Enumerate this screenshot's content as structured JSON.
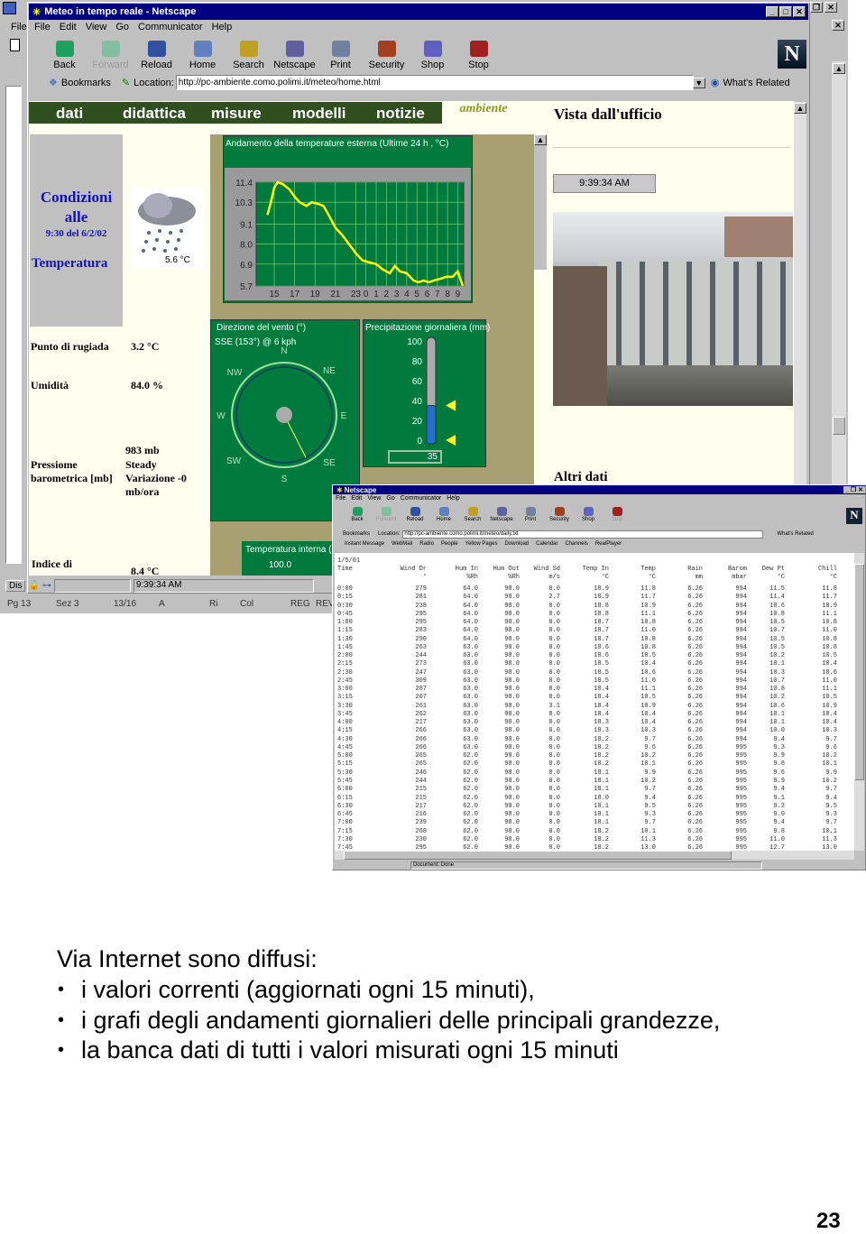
{
  "outer": {
    "menu_file": "File",
    "status": "Dis",
    "word_status": [
      "Pg 13",
      "Sez 3",
      "13/16",
      "A",
      "Ri",
      "Col",
      "REG",
      "REV"
    ]
  },
  "browser": {
    "title": "Meteo in tempo reale - Netscape",
    "menu": [
      "File",
      "Edit",
      "View",
      "Go",
      "Communicator",
      "Help"
    ],
    "toolbar": [
      "Back",
      "Forward",
      "Reload",
      "Home",
      "Search",
      "Netscape",
      "Print",
      "Security",
      "Shop",
      "Stop"
    ],
    "bookmarks": "Bookmarks",
    "location_label": "Location:",
    "url": "http://pc-ambiente.como.polimi.it/meteo/home.html",
    "whats_related": "What's Related",
    "status_time": "9:39:34 AM"
  },
  "site": {
    "nav": [
      "dati",
      "didattica",
      "misure",
      "modelli",
      "notizie"
    ],
    "logo": "ambiente como",
    "conditions_title": "Condizioni alle",
    "conditions_time": "9:30 del 6/2/02",
    "temperature_label": "Temperatura",
    "temperature_value": "5.6 °C",
    "dew_label": "Punto di rugiada",
    "dew_value": "3.2 °C",
    "hum_label": "Umidità",
    "hum_value": "84.0 %",
    "press_label": "Pressiome barometrica [mb]",
    "press_value": "983 mb",
    "press_trend": "Steady",
    "press_var": "Variazione -0 mb/ora",
    "index_label": "Indice di",
    "index_value": "8.4 °C",
    "view_title": "Vista dall'ufficio",
    "view_time": "9:39:34 AM",
    "other_title": "Altri dati",
    "temp_chart": {
      "title": "Andamento della temperature  esterna (Ultime 24 h  , °C)",
      "y_ticks": [
        "11.4",
        "10.3",
        "9.1",
        "8.0",
        "6.9",
        "5.7"
      ],
      "ylim": [
        5.7,
        11.4
      ],
      "x_ticks": [
        "15",
        "17",
        "19",
        "21",
        "23",
        "0",
        "1",
        "2",
        "3",
        "4",
        "5",
        "6",
        "7",
        "8",
        "9"
      ],
      "points": [
        [
          "14:20",
          9.6
        ],
        [
          "14:40",
          10.3
        ],
        [
          "15:00",
          11.1
        ],
        [
          "15:20",
          11.4
        ],
        [
          "15:50",
          11.3
        ],
        [
          "16:30",
          11.0
        ],
        [
          "17:00",
          10.6
        ],
        [
          "17:30",
          10.3
        ],
        [
          "18:10",
          10.1
        ],
        [
          "18:40",
          10.3
        ],
        [
          "19:20",
          10.2
        ],
        [
          "19:50",
          10.1
        ],
        [
          "20:20",
          9.6
        ],
        [
          "21:00",
          8.9
        ],
        [
          "21:40",
          8.5
        ],
        [
          "22:20",
          8.0
        ],
        [
          "23:00",
          7.5
        ],
        [
          "23:40",
          7.1
        ],
        [
          "0:20",
          7.0
        ],
        [
          "1:00",
          6.9
        ],
        [
          "1:40",
          6.6
        ],
        [
          "2:20",
          6.4
        ],
        [
          "2:50",
          6.8
        ],
        [
          "3:20",
          6.5
        ],
        [
          "4:00",
          6.4
        ],
        [
          "4:40",
          6.0
        ],
        [
          "5:10",
          5.9
        ],
        [
          "5:40",
          6.0
        ],
        [
          "6:10",
          5.9
        ],
        [
          "6:40",
          6.0
        ],
        [
          "7:20",
          6.1
        ],
        [
          "7:50",
          6.2
        ],
        [
          "8:30",
          6.2
        ],
        [
          "9:00",
          6.5
        ],
        [
          "9:30",
          5.7
        ]
      ],
      "line_color": "#ffff00",
      "bg_color": "#007a3d"
    },
    "wind": {
      "title": "Direzione del vento (°)",
      "reading": "SSE (153°) @ 6 kph",
      "direction_deg": 153,
      "labels": [
        "N",
        "NE",
        "E",
        "SE",
        "S",
        "SW",
        "W",
        "NW"
      ]
    },
    "precip": {
      "title": "Precipitazione giornaliera (mm)",
      "ticks": [
        "100",
        "80",
        "60",
        "40",
        "20",
        "0"
      ],
      "level_mm": 35,
      "value": "35"
    },
    "internal": {
      "title": "Temperatura interna (°C)",
      "tick": "100.0"
    }
  },
  "browser2": {
    "title": "Netscape",
    "menu": [
      "File",
      "Edit",
      "View",
      "Go",
      "Communicator",
      "Help"
    ],
    "toolbar": [
      "Back",
      "Forward",
      "Reload",
      "Home",
      "Search",
      "Netscape",
      "Print",
      "Security",
      "Shop",
      "Stop"
    ],
    "bookmarks": "Bookmarks",
    "location_label": "Location:",
    "url": "http://pc-ambiente.como.polimi.it/meteo/daily.txt",
    "whats_related": "What's Related",
    "personal": [
      "Instant Message",
      "WebMail",
      "Radio",
      "People",
      "Yellow Pages",
      "Download",
      "Calendar",
      "Channels",
      "RealPlayer"
    ],
    "status": "Document: Done",
    "date": "1/5/01",
    "headers": [
      "Time",
      "Wind Dr",
      "Hum In",
      "Hum Out",
      "Wind Sd",
      "Temp In",
      "Temp",
      "Rain",
      "Barom",
      "Dew Pt",
      "Chill"
    ],
    "units": [
      "",
      "°",
      "%Rh",
      "%Rh",
      "m/s",
      "°C",
      "°C",
      "mm",
      "mbar",
      "°C",
      "°C"
    ],
    "rows": [
      [
        "0:00",
        "279",
        "64.0",
        "98.0",
        "0.0",
        "18.9",
        "11.8",
        "6.26",
        "994",
        "11.5",
        "11.8"
      ],
      [
        "0:15",
        "281",
        "64.0",
        "98.0",
        "2.7",
        "18.9",
        "11.7",
        "6.26",
        "994",
        "11.4",
        "11.7"
      ],
      [
        "0:30",
        "238",
        "64.0",
        "98.0",
        "0.0",
        "18.8",
        "10.9",
        "6.26",
        "994",
        "10.6",
        "10.9"
      ],
      [
        "0:45",
        "295",
        "64.0",
        "98.0",
        "0.0",
        "18.8",
        "11.1",
        "6.26",
        "994",
        "10.8",
        "11.1"
      ],
      [
        "1:00",
        "295",
        "64.0",
        "98.0",
        "0.0",
        "18.7",
        "10.8",
        "6.26",
        "994",
        "10.5",
        "10.8"
      ],
      [
        "1:15",
        "283",
        "64.0",
        "98.0",
        "0.0",
        "18.7",
        "11.0",
        "6.26",
        "994",
        "10.7",
        "11.0"
      ],
      [
        "1:30",
        "290",
        "64.0",
        "98.0",
        "0.0",
        "18.7",
        "10.8",
        "6.26",
        "994",
        "10.5",
        "10.8"
      ],
      [
        "1:45",
        "263",
        "63.0",
        "98.0",
        "0.0",
        "18.6",
        "10.8",
        "6.26",
        "994",
        "10.5",
        "10.8"
      ],
      [
        "2:00",
        "244",
        "63.0",
        "98.0",
        "0.0",
        "18.6",
        "10.5",
        "6.26",
        "994",
        "10.2",
        "10.5"
      ],
      [
        "2:15",
        "273",
        "63.0",
        "98.0",
        "0.0",
        "18.5",
        "10.4",
        "6.26",
        "994",
        "10.1",
        "10.4"
      ],
      [
        "2:30",
        "247",
        "63.0",
        "98.0",
        "0.0",
        "18.5",
        "10.6",
        "6.26",
        "994",
        "10.3",
        "10.6"
      ],
      [
        "2:45",
        "309",
        "63.0",
        "98.0",
        "0.0",
        "18.5",
        "11.0",
        "6.26",
        "994",
        "10.7",
        "11.0"
      ],
      [
        "3:00",
        "287",
        "63.0",
        "98.0",
        "0.0",
        "18.4",
        "11.1",
        "6.26",
        "994",
        "10.8",
        "11.1"
      ],
      [
        "3:15",
        "207",
        "63.0",
        "98.0",
        "0.0",
        "18.4",
        "10.5",
        "6.26",
        "994",
        "10.2",
        "10.5"
      ],
      [
        "3:30",
        "261",
        "63.0",
        "98.0",
        "3.1",
        "18.4",
        "10.9",
        "6.26",
        "994",
        "10.6",
        "10.9"
      ],
      [
        "3:45",
        "262",
        "63.0",
        "98.0",
        "0.0",
        "18.4",
        "10.4",
        "6.26",
        "994",
        "10.1",
        "10.4"
      ],
      [
        "4:00",
        "217",
        "63.0",
        "98.0",
        "0.0",
        "18.3",
        "10.4",
        "6.26",
        "994",
        "10.1",
        "10.4"
      ],
      [
        "4:15",
        "266",
        "63.0",
        "98.0",
        "0.0",
        "18.3",
        "10.3",
        "6.26",
        "994",
        "10.0",
        "10.3"
      ],
      [
        "4:30",
        "266",
        "63.0",
        "98.0",
        "0.0",
        "18.2",
        "9.7",
        "6.26",
        "994",
        "9.4",
        "9.7"
      ],
      [
        "4:45",
        "266",
        "63.0",
        "98.0",
        "0.0",
        "18.2",
        "9.6",
        "6.26",
        "995",
        "9.3",
        "9.6"
      ],
      [
        "5:00",
        "265",
        "62.0",
        "98.0",
        "0.0",
        "18.2",
        "10.2",
        "6.26",
        "995",
        "9.9",
        "10.2"
      ],
      [
        "5:15",
        "265",
        "62.0",
        "98.0",
        "0.0",
        "18.2",
        "10.1",
        "6.26",
        "995",
        "9.8",
        "10.1"
      ],
      [
        "5:30",
        "246",
        "62.0",
        "98.0",
        "0.0",
        "18.1",
        "9.9",
        "6.26",
        "995",
        "9.6",
        "9.9"
      ],
      [
        "5:45",
        "244",
        "62.0",
        "98.0",
        "0.0",
        "18.1",
        "10.2",
        "6.26",
        "995",
        "9.9",
        "10.2"
      ],
      [
        "6:00",
        "215",
        "62.0",
        "98.0",
        "0.0",
        "18.1",
        "9.7",
        "6.26",
        "995",
        "9.4",
        "9.7"
      ],
      [
        "6:15",
        "215",
        "62.0",
        "98.0",
        "0.0",
        "18.0",
        "9.4",
        "6.26",
        "995",
        "9.1",
        "9.4"
      ],
      [
        "6:30",
        "217",
        "62.0",
        "98.0",
        "0.0",
        "18.1",
        "9.5",
        "6.26",
        "995",
        "9.2",
        "9.5"
      ],
      [
        "6:45",
        "216",
        "62.0",
        "98.0",
        "0.0",
        "18.1",
        "9.3",
        "6.26",
        "995",
        "9.0",
        "9.3"
      ],
      [
        "7:00",
        "239",
        "62.0",
        "98.0",
        "0.0",
        "18.1",
        "9.7",
        "6.26",
        "995",
        "9.4",
        "9.7"
      ],
      [
        "7:15",
        "268",
        "62.0",
        "98.0",
        "0.0",
        "18.2",
        "10.1",
        "6.26",
        "995",
        "9.8",
        "10.1"
      ],
      [
        "7:30",
        "230",
        "62.0",
        "98.0",
        "0.0",
        "18.2",
        "11.3",
        "6.26",
        "995",
        "11.0",
        "11.3"
      ],
      [
        "7:45",
        "295",
        "62.0",
        "98.0",
        "0.0",
        "18.2",
        "13.0",
        "6.26",
        "995",
        "12.7",
        "13.0"
      ]
    ]
  },
  "slide": {
    "intro": "Via Internet sono diffusi:",
    "bullets": [
      "i valori correnti (aggiornati ogni 15 minuti),",
      "i grafi degli andamenti giornalieri delle principali grandezze,",
      "la banca dati di tutti i valori misurati ogni 15 minuti"
    ],
    "page_number": "23"
  }
}
